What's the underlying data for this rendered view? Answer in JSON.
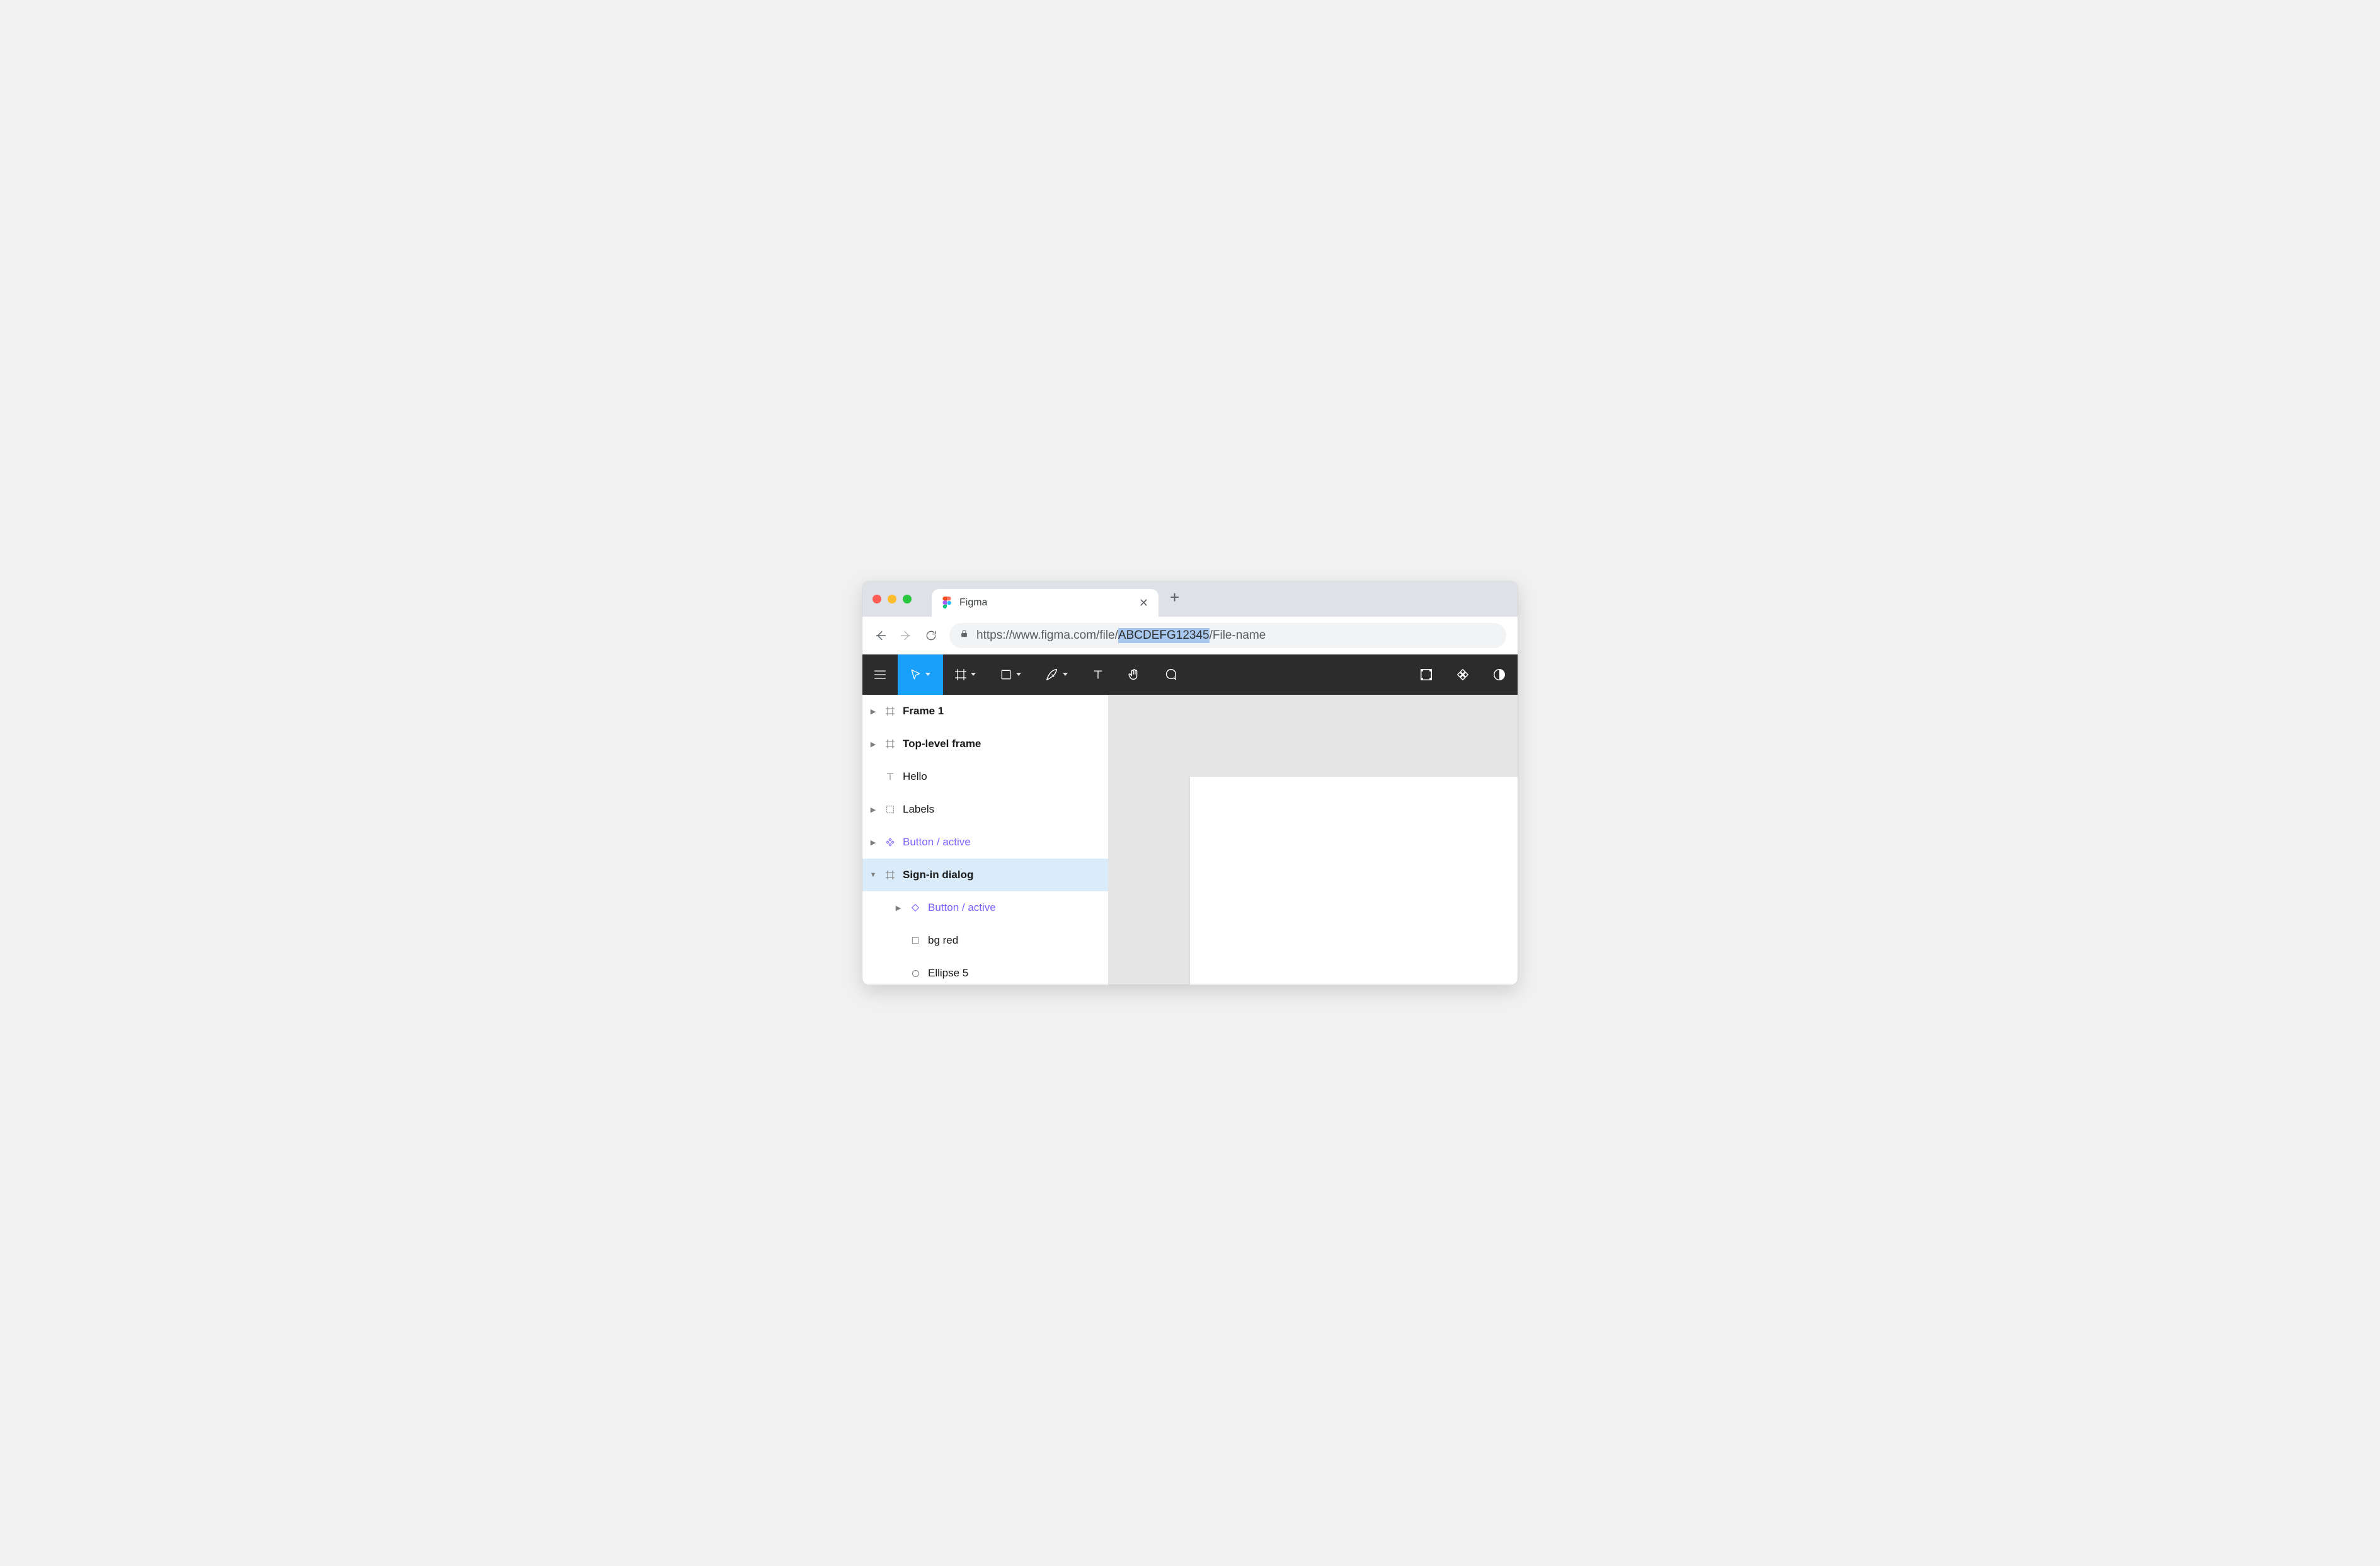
{
  "browser": {
    "tab_title": "Figma",
    "url_prefix": "https://www.figma.com/file/",
    "url_file_id": "ABCDEFG12345",
    "url_suffix": "/File-name"
  },
  "toolbar": {
    "tools": [
      "menu",
      "move",
      "frame",
      "shape",
      "pen",
      "text",
      "hand",
      "comment"
    ],
    "right_tools": [
      "components",
      "plugins",
      "dark-mode"
    ]
  },
  "layers": {
    "items": [
      {
        "kind": "frame",
        "label": "Frame 1",
        "bold": true,
        "caret": "right",
        "depth": 0,
        "selected": false,
        "purple": false
      },
      {
        "kind": "frame",
        "label": "Top-level frame",
        "bold": true,
        "caret": "right",
        "depth": 0,
        "selected": false,
        "purple": false
      },
      {
        "kind": "text",
        "label": "Hello",
        "bold": false,
        "caret": "",
        "depth": 0,
        "selected": false,
        "purple": false
      },
      {
        "kind": "group",
        "label": "Labels",
        "bold": false,
        "caret": "right",
        "depth": 0,
        "selected": false,
        "purple": false
      },
      {
        "kind": "component",
        "label": "Button / active",
        "bold": false,
        "caret": "right",
        "depth": 0,
        "selected": false,
        "purple": true
      },
      {
        "kind": "frame",
        "label": "Sign-in dialog",
        "bold": true,
        "caret": "down",
        "depth": 0,
        "selected": true,
        "purple": false
      },
      {
        "kind": "instance",
        "label": "Button / active",
        "bold": false,
        "caret": "right",
        "depth": 1,
        "selected": false,
        "purple": true
      },
      {
        "kind": "rect",
        "label": "bg red",
        "bold": false,
        "caret": "",
        "depth": 1,
        "selected": false,
        "purple": false
      },
      {
        "kind": "ellipse",
        "label": "Ellipse 5",
        "bold": false,
        "caret": "",
        "depth": 1,
        "selected": false,
        "purple": false
      }
    ]
  },
  "colors": {
    "accent": "#18a0fb",
    "component": "#7b61ff",
    "selection_bg": "#daebf9",
    "url_highlight": "#a8c8f0"
  }
}
